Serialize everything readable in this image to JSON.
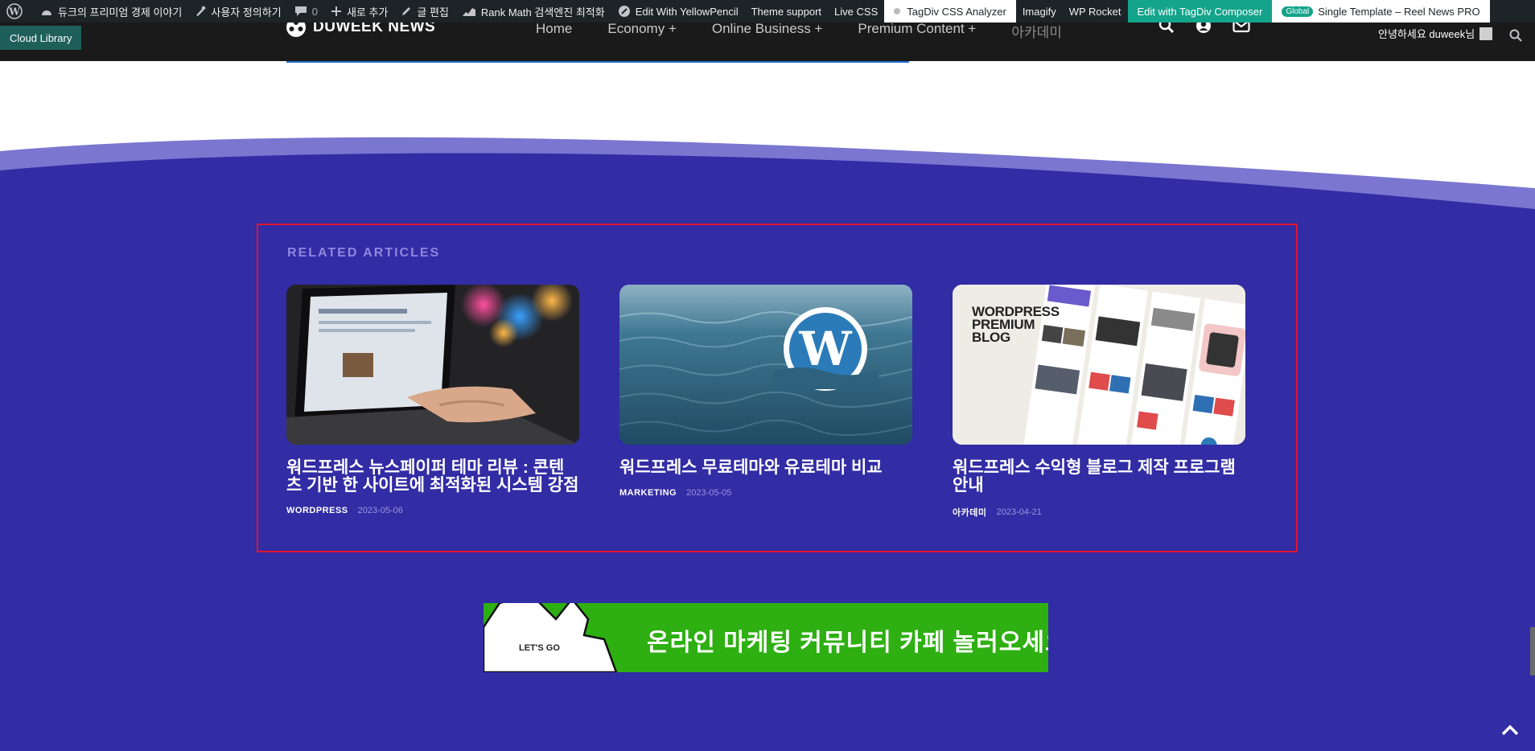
{
  "admin_bar": {
    "site_name": "듀크의 프리미엄 경제 이야기",
    "customize": "사용자 정의하기",
    "comments_count": "0",
    "new": "새로 추가",
    "edit_post": "글 편집",
    "rank_math": "Rank Math 검색엔진 최적화",
    "yellowpencil": "Edit With YellowPencil",
    "theme_support": "Theme support",
    "live_css": "Live CSS",
    "tagdiv_analyzer": "TagDiv CSS Analyzer",
    "imagify": "Imagify",
    "wp_rocket": "WP Rocket",
    "tagdiv_composer": "Edit with TagDiv Composer",
    "global_badge": "Global",
    "template": "Single Template – Reel News PRO"
  },
  "header": {
    "cloud_library": "Cloud Library",
    "logo": "DUWEEK NEWS",
    "nav": [
      "Home",
      "Economy  +",
      "Online Business  +",
      "Premium Content  +",
      "아카데미"
    ],
    "greeting": "안녕하세요 duweek님"
  },
  "related": {
    "title": "RELATED ARTICLES",
    "articles": [
      {
        "title": "워드프레스 뉴스페이퍼 테마 리뷰 : 콘텐츠 기반 한 사이트에 최적화된 시스템 강점",
        "category": "WORDPRESS",
        "date": "2023-05-06",
        "thumb": "laptop-typing"
      },
      {
        "title": "워드프레스 무료테마와 유료테마 비교",
        "category": "MARKETING",
        "date": "2023-05-05",
        "thumb": "wordpress-logo-in-water"
      },
      {
        "title": "워드프레스 수익형 블로그 제작 프로그램 안내",
        "category": "아카데미",
        "date": "2023-04-21",
        "thumb": "wordpress-premium-blog"
      }
    ],
    "thumb3_text": "WORDPRESS PREMIUM BLOG"
  },
  "banner": {
    "small": "LET'S GO",
    "text": "온라인 마케팅 커뮤니티 카페 놀러오세요"
  },
  "colors": {
    "footer_bg": "#322ca5",
    "wave_light": "#7b76cf",
    "highlight_border": "#e5132b",
    "banner_green": "#2eaf12"
  }
}
